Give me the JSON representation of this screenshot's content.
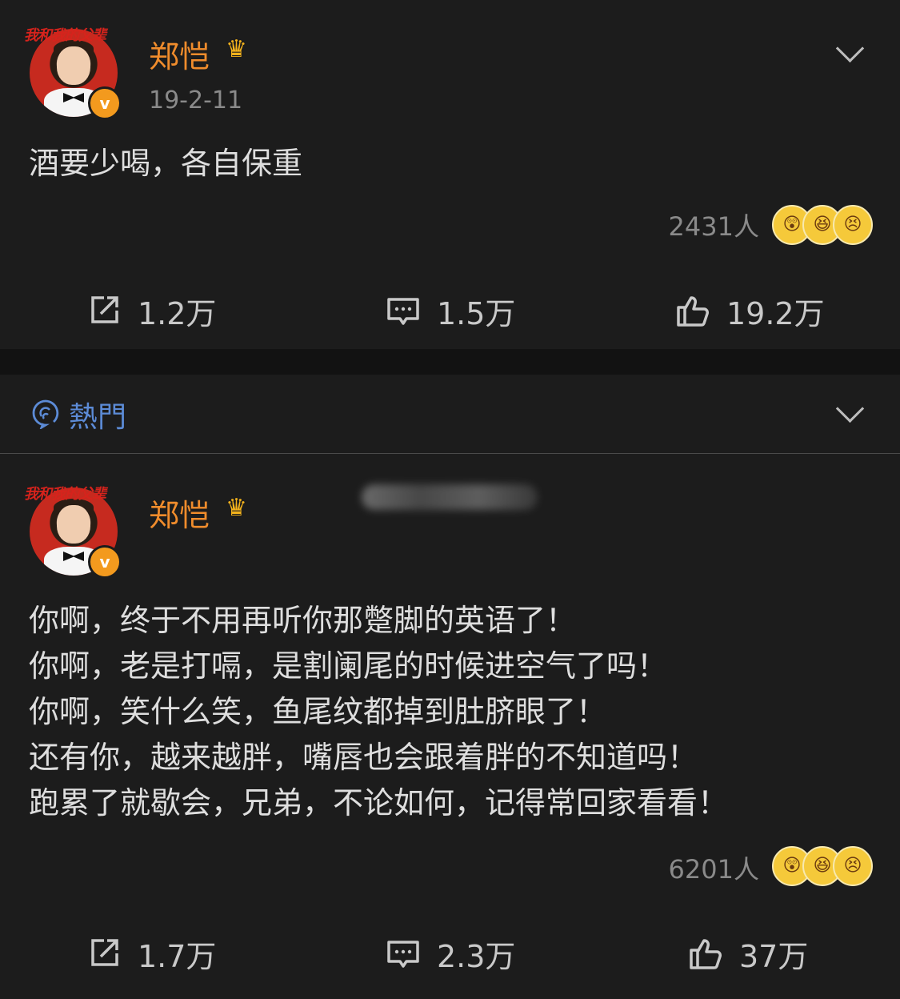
{
  "post1": {
    "author": "郑恺",
    "date": "19-2-11",
    "content": [
      "酒要少喝，各自保重"
    ],
    "reactions_count": "2431人",
    "actions": {
      "repost": "1.2万",
      "comment": "1.5万",
      "like": "19.2万"
    }
  },
  "hot_section": {
    "label": "熱門"
  },
  "post2": {
    "author": "郑恺",
    "content": [
      "你啊，终于不用再听你那蹩脚的英语了！",
      "你啊，老是打嗝，是割阑尾的时候进空气了吗！",
      "你啊，笑什么笑，鱼尾纹都掉到肚脐眼了！",
      "还有你，越来越胖，嘴唇也会跟着胖的不知道吗！",
      "跑累了就歇会，兄弟，不论如何，记得常回家看看！"
    ],
    "reactions_count": "6201人",
    "actions": {
      "repost": "1.7万",
      "comment": "2.3万",
      "like": "37万"
    }
  },
  "avatar_logo_text": "我和我的父辈",
  "icons": {
    "verified": "verified-badge-icon",
    "crown": "crown-icon",
    "chevron": "chevron-down-icon",
    "repost": "repost-icon",
    "comment": "comment-icon",
    "like": "thumbs-up-icon",
    "hot": "hot-icon"
  },
  "colors": {
    "author_name": "#f08c2c",
    "hot_label": "#5c8bd6",
    "background": "#1c1c1c"
  }
}
